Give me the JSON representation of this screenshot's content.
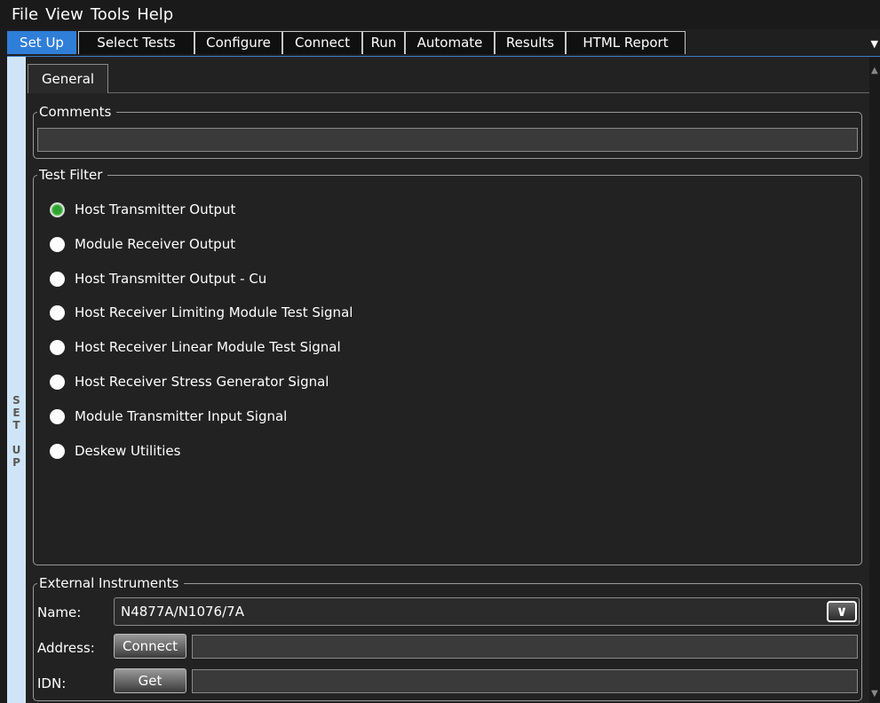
{
  "menu": [
    "File",
    "View",
    "Tools",
    "Help"
  ],
  "tabs": [
    "Set Up",
    "Select Tests",
    "Configure",
    "Connect",
    "Run",
    "Automate",
    "Results",
    "HTML Report"
  ],
  "sidebar_label": "S E T   U P",
  "subtab": "General",
  "comments": {
    "legend": "Comments",
    "value": ""
  },
  "test_filter": {
    "legend": "Test Filter",
    "selected_index": 0,
    "options": [
      "Host Transmitter Output",
      "Module Receiver Output",
      "Host Transmitter Output - Cu",
      "Host Receiver Limiting Module Test Signal",
      "Host Receiver Linear Module Test Signal",
      "Host Receiver Stress Generator Signal",
      "Module Transmitter Input Signal",
      "Deskew Utilities"
    ]
  },
  "external": {
    "legend": "External Instruments",
    "name_label": "Name:",
    "name_value": "N4877A/N1076/7A",
    "address_label": "Address:",
    "connect_label": "Connect",
    "address_value": "",
    "idn_label": "IDN:",
    "get_label": "Get",
    "idn_value": ""
  },
  "icons": {
    "dropdown": "chevron-down-icon",
    "tab_overflow": "caret-down-icon",
    "scroll_up": "arrow-up-icon",
    "scroll_down": "arrow-down-icon"
  }
}
